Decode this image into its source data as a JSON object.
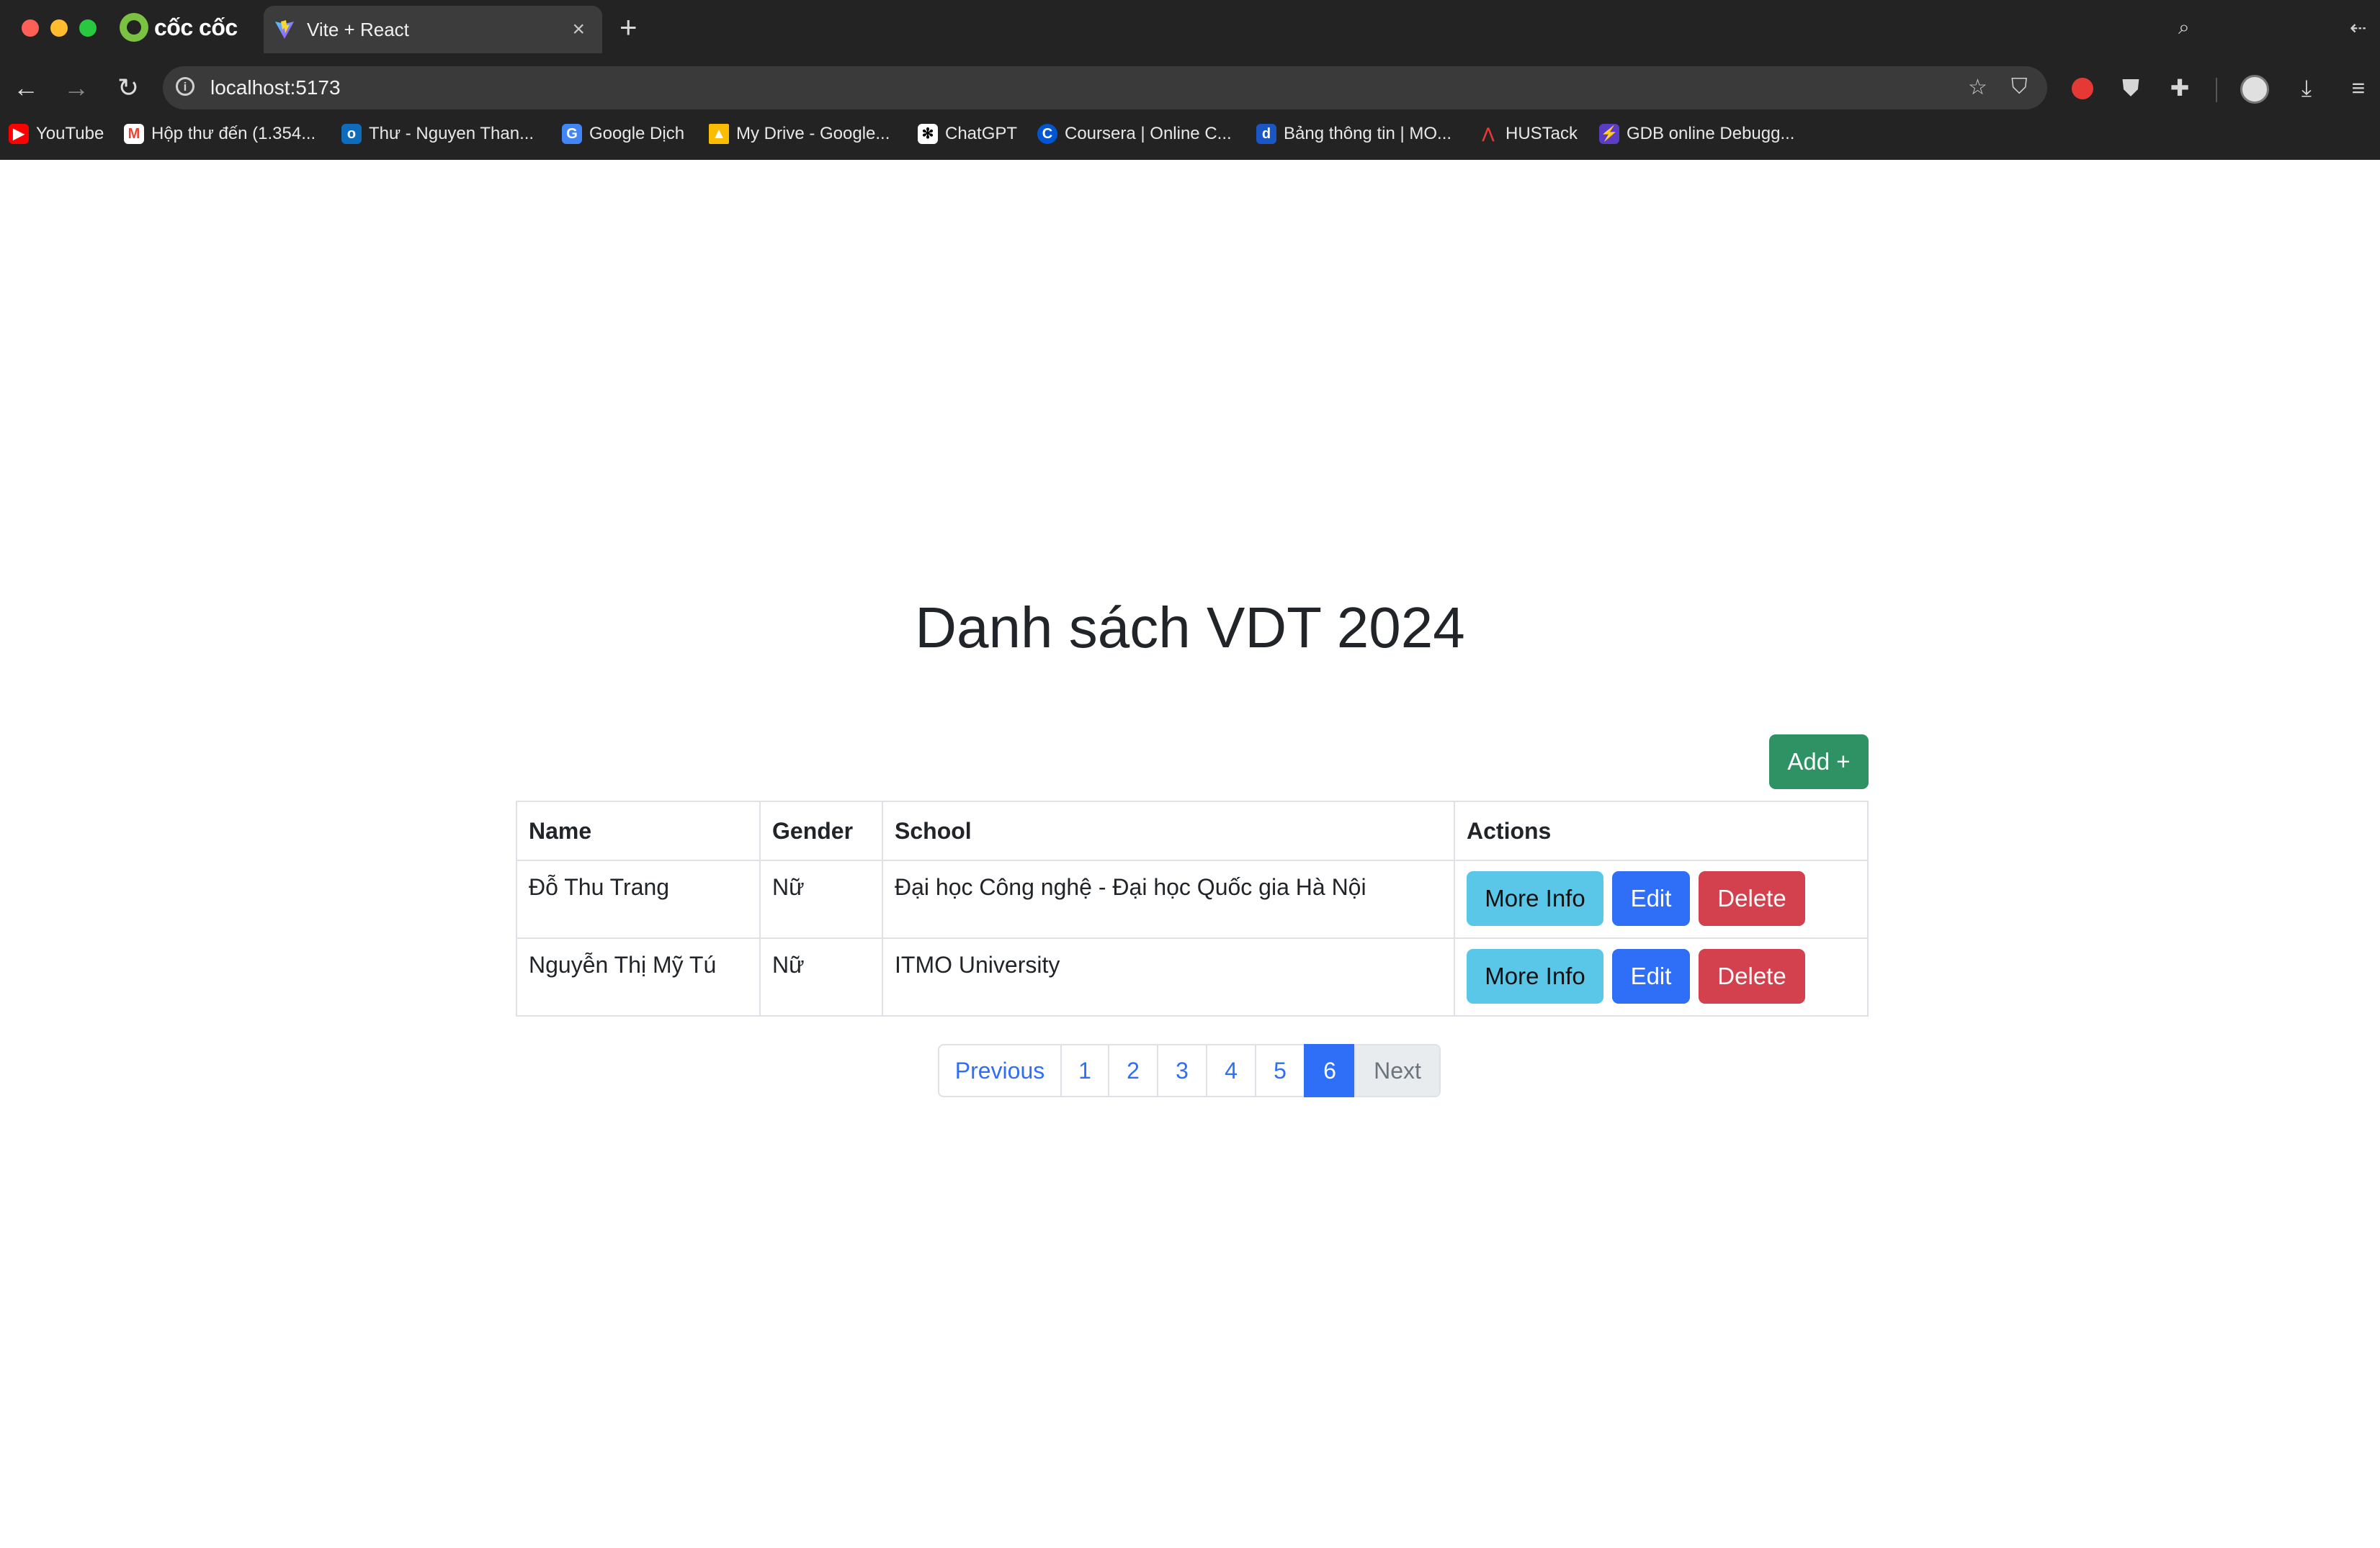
{
  "browser": {
    "brand": "cốc cốc",
    "tab_title": "Vite + React",
    "url": "localhost:5173",
    "bookmarks": [
      {
        "label": "YouTube",
        "icon": "youtube-icon",
        "color": "#ff0000"
      },
      {
        "label": "Hộp thư đến (1.354...",
        "icon": "gmail-icon",
        "color": "#ea4335"
      },
      {
        "label": "Thư - Nguyen Than...",
        "icon": "outlook-icon",
        "color": "#0f6cbd"
      },
      {
        "label": "Google Dịch",
        "icon": "google-translate-icon",
        "color": "#4285f4"
      },
      {
        "label": "My Drive - Google...",
        "icon": "google-drive-icon",
        "color": "#fbbc04"
      },
      {
        "label": "ChatGPT",
        "icon": "chatgpt-icon",
        "color": "#ffffff"
      },
      {
        "label": "Coursera | Online C...",
        "icon": "coursera-icon",
        "color": "#0056d2"
      },
      {
        "label": "Bảng thông tin | MO...",
        "icon": "moodle-icon",
        "color": "#1a56c4"
      },
      {
        "label": "HUSTack",
        "icon": "hustack-icon",
        "color": "#c0392b"
      },
      {
        "label": "GDB online Debugg...",
        "icon": "gdb-icon",
        "color": "#5b3cc4"
      }
    ]
  },
  "page": {
    "title": "Danh sách VDT 2024",
    "add_label": "Add +"
  },
  "table": {
    "headers": [
      "Name",
      "Gender",
      "School",
      "Actions"
    ],
    "rows": [
      {
        "name": "Đỗ Thu Trang",
        "gender": "Nữ",
        "school": "Đại học Công nghệ - Đại học Quốc gia Hà Nội"
      },
      {
        "name": "Nguyễn Thị Mỹ Tú",
        "gender": "Nữ",
        "school": "ITMO University"
      }
    ],
    "actions": {
      "more_info": "More Info",
      "edit": "Edit",
      "delete": "Delete"
    }
  },
  "pagination": {
    "previous": "Previous",
    "pages": [
      "1",
      "2",
      "3",
      "4",
      "5",
      "6"
    ],
    "current": "6",
    "next": "Next"
  },
  "colors": {
    "add": "#198754",
    "info": "#5bc7e8",
    "primary": "#2f6ef6",
    "danger": "#d2414d"
  }
}
